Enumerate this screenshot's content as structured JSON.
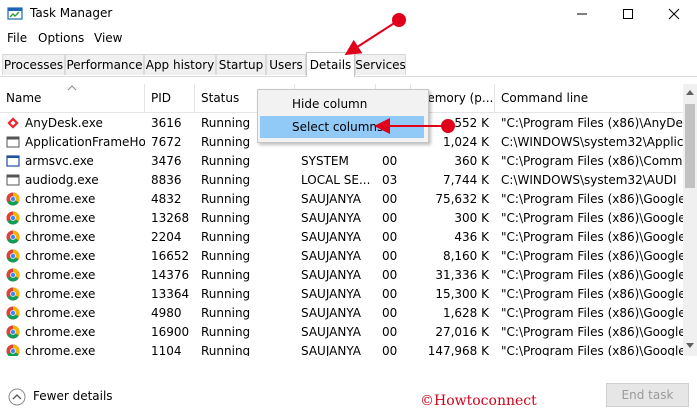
{
  "window": {
    "title": "Task Manager"
  },
  "menu": [
    "File",
    "Options",
    "View"
  ],
  "tabs": [
    "Processes",
    "Performance",
    "App history",
    "Startup",
    "Users",
    "Details",
    "Services"
  ],
  "active_tab": "Details",
  "columns": [
    "Name",
    "PID",
    "Status",
    "",
    "",
    "Memory (p...",
    "Command line"
  ],
  "rows": [
    {
      "name": "AnyDesk.exe",
      "pid": "3616",
      "status": "Running",
      "user": "",
      "cpu": "",
      "mem": "552 K",
      "cmd": "\"C:\\Program Files (x86)\\AnyDes",
      "icon": "anydesk-icon"
    },
    {
      "name": "ApplicationFrameHo...",
      "pid": "7672",
      "status": "Running",
      "user": "",
      "cpu": "",
      "mem": "1,024 K",
      "cmd": "C:\\WINDOWS\\system32\\Applic",
      "icon": "app-frame-icon"
    },
    {
      "name": "armsvc.exe",
      "pid": "3476",
      "status": "Running",
      "user": "SYSTEM",
      "cpu": "00",
      "mem": "360 K",
      "cmd": "\"C:\\Program Files (x86)\\Comm",
      "icon": "window-icon"
    },
    {
      "name": "audiodg.exe",
      "pid": "8836",
      "status": "Running",
      "user": "LOCAL SE...",
      "cpu": "03",
      "mem": "7,744 K",
      "cmd": "C:\\WINDOWS\\system32\\AUDI",
      "icon": "app-frame-icon"
    },
    {
      "name": "chrome.exe",
      "pid": "4832",
      "status": "Running",
      "user": "SAUJANYA",
      "cpu": "00",
      "mem": "75,632 K",
      "cmd": "\"C:\\Program Files (x86)\\Google",
      "icon": "chrome-icon"
    },
    {
      "name": "chrome.exe",
      "pid": "13268",
      "status": "Running",
      "user": "SAUJANYA",
      "cpu": "00",
      "mem": "300 K",
      "cmd": "\"C:\\Program Files (x86)\\Google",
      "icon": "chrome-icon"
    },
    {
      "name": "chrome.exe",
      "pid": "2204",
      "status": "Running",
      "user": "SAUJANYA",
      "cpu": "00",
      "mem": "436 K",
      "cmd": "\"C:\\Program Files (x86)\\Google",
      "icon": "chrome-icon"
    },
    {
      "name": "chrome.exe",
      "pid": "16652",
      "status": "Running",
      "user": "SAUJANYA",
      "cpu": "00",
      "mem": "8,160 K",
      "cmd": "\"C:\\Program Files (x86)\\Google",
      "icon": "chrome-icon"
    },
    {
      "name": "chrome.exe",
      "pid": "14376",
      "status": "Running",
      "user": "SAUJANYA",
      "cpu": "00",
      "mem": "31,336 K",
      "cmd": "\"C:\\Program Files (x86)\\Google",
      "icon": "chrome-icon"
    },
    {
      "name": "chrome.exe",
      "pid": "13364",
      "status": "Running",
      "user": "SAUJANYA",
      "cpu": "00",
      "mem": "15,300 K",
      "cmd": "\"C:\\Program Files (x86)\\Google",
      "icon": "chrome-icon"
    },
    {
      "name": "chrome.exe",
      "pid": "4980",
      "status": "Running",
      "user": "SAUJANYA",
      "cpu": "00",
      "mem": "1,628 K",
      "cmd": "\"C:\\Program Files (x86)\\Google",
      "icon": "chrome-icon"
    },
    {
      "name": "chrome.exe",
      "pid": "16900",
      "status": "Running",
      "user": "SAUJANYA",
      "cpu": "00",
      "mem": "27,016 K",
      "cmd": "\"C:\\Program Files (x86)\\Google",
      "icon": "chrome-icon"
    },
    {
      "name": "chrome.exe",
      "pid": "1104",
      "status": "Running",
      "user": "SAUJANYA",
      "cpu": "00",
      "mem": "147,968 K",
      "cmd": "\"C:\\Program Files (x86)\\Google",
      "icon": "chrome-icon"
    }
  ],
  "context_menu": {
    "items": [
      "Hide column",
      "Select columns"
    ],
    "selected": "Select columns"
  },
  "footer": {
    "fewer_details": "Fewer details",
    "end_task": "End task"
  },
  "watermark": "©Howtoconnect",
  "colors": {
    "accent": "#0078d7",
    "arrow": "#e0001b",
    "selection": "#91c9f7"
  }
}
